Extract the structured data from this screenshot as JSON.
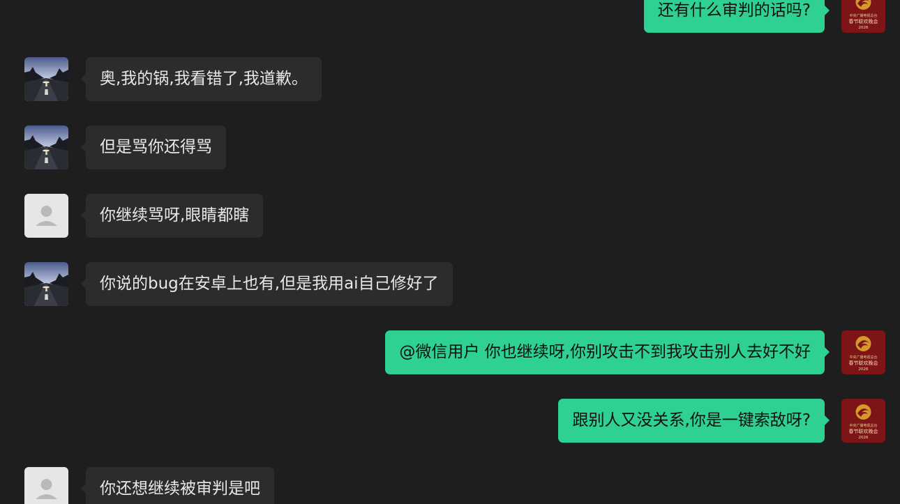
{
  "colors": {
    "background": "#1e1e1e",
    "incoming_bubble": "#2c2c2c",
    "outgoing_bubble": "#2ed192",
    "incoming_text": "#e8e8e8",
    "outgoing_text": "#101010"
  },
  "messages": [
    {
      "side": "out",
      "avatar": "gala-logo-avatar",
      "text": "还有什么审判的话吗?"
    },
    {
      "side": "in",
      "avatar": "road-dusk-avatar",
      "text": "奥,我的锅,我看错了,我道歉。"
    },
    {
      "side": "in",
      "avatar": "road-dusk-avatar",
      "text": "但是骂你还得骂"
    },
    {
      "side": "in",
      "avatar": "default-user-avatar",
      "text": "你继续骂呀,眼睛都瞎"
    },
    {
      "side": "in",
      "avatar": "road-dusk-avatar",
      "text": "你说的bug在安卓上也有,但是我用ai自己修好了"
    },
    {
      "side": "out",
      "avatar": "gala-logo-avatar",
      "text": "@微信用户 你也继续呀,你别攻击不到我攻击别人去好不好"
    },
    {
      "side": "out",
      "avatar": "gala-logo-avatar",
      "text": "跟别人又没关系,你是一键索敌呀?"
    },
    {
      "side": "in",
      "avatar": "default-user-avatar",
      "text": "你还想继续被审判是吧"
    }
  ],
  "gala_logo": {
    "small_text": "中央广播电视总台",
    "title": "春节联欢晚会",
    "year": "2026"
  }
}
